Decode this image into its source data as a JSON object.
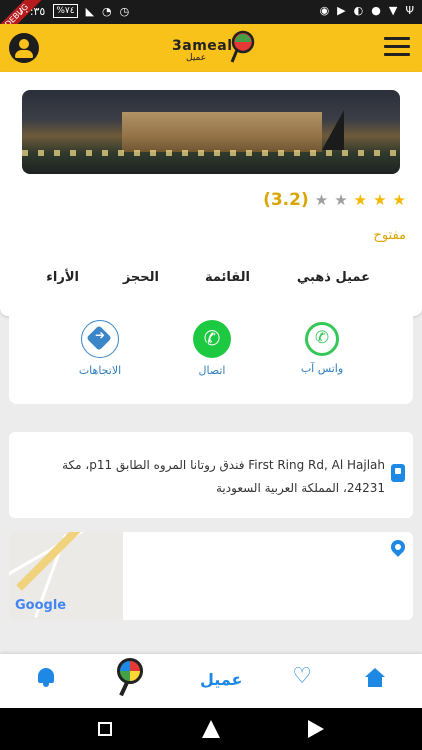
{
  "status_bar": {
    "time": "١٠:٣٥",
    "battery": "%٧٤",
    "debug_label": "DEBUG"
  },
  "app_bar": {
    "logo_text": "3ameal",
    "logo_subtext": "عميل"
  },
  "venue": {
    "rating": "(3.2)",
    "stars_filled": 3,
    "stars_total": 5,
    "status": "مفتوح"
  },
  "tabs": [
    {
      "label": "عميل ذهبي"
    },
    {
      "label": "القائمة"
    },
    {
      "label": "الحجز"
    },
    {
      "label": "الأراء"
    }
  ],
  "actions": {
    "whatsapp": "واتس آب",
    "call": "اتصال",
    "directions": "الاتجاهات"
  },
  "address": {
    "text": "First Ring Rd, Al Hajlah فندق روتانا المروه الطابق p11، مكة 24231، المملكة العربية السعودية"
  },
  "map": {
    "attribution": "Google"
  },
  "bottom_nav": {
    "brand_text": "عميل"
  },
  "colors": {
    "brand_yellow": "#f9c21b",
    "accent_blue": "#1e88e5",
    "open_status": "#d9a500"
  }
}
